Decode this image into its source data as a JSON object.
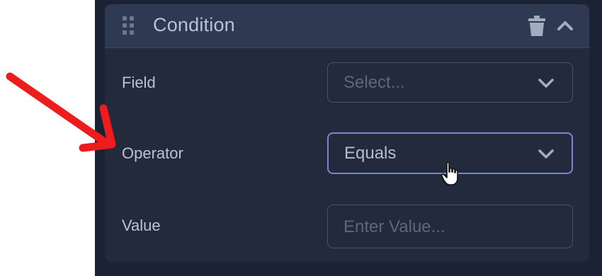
{
  "condition_panel": {
    "title": "Condition",
    "header_icons": [
      "drag-handle-icon",
      "trash-icon",
      "chevron-up-icon"
    ],
    "rows": [
      {
        "label": "Field",
        "control": "select",
        "placeholder": "Select...",
        "value": ""
      },
      {
        "label": "Operator",
        "control": "select",
        "placeholder": "",
        "value": "Equals"
      },
      {
        "label": "Value",
        "control": "input",
        "placeholder": "Enter Value...",
        "value": ""
      }
    ]
  },
  "colors": {
    "background": "#1b2233",
    "panel": "#222a3b",
    "header": "#2f3a52",
    "focus_border": "#7a86d4",
    "annotation_arrow": "#ee1c1c"
  }
}
